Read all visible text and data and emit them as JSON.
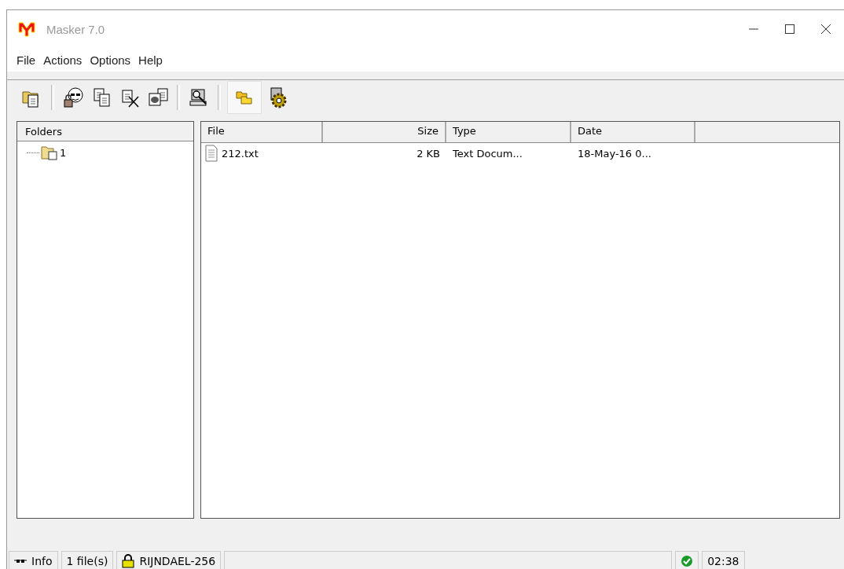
{
  "window": {
    "title": "Masker 7.0"
  },
  "menu": [
    "File",
    "Actions",
    "Options",
    "Help"
  ],
  "toolbar": [
    [
      {
        "kind": "open-folder",
        "selected": false
      }
    ],
    [
      {
        "kind": "mask-lock",
        "selected": false
      },
      {
        "kind": "copy",
        "selected": false
      },
      {
        "kind": "delete",
        "selected": false
      },
      {
        "kind": "image",
        "selected": false
      }
    ],
    [
      {
        "kind": "search",
        "selected": false
      }
    ],
    [
      {
        "kind": "folders",
        "selected": true
      },
      {
        "kind": "gear",
        "selected": false
      }
    ]
  ],
  "folders": {
    "header": "Folders",
    "items": [
      {
        "label": "1"
      }
    ]
  },
  "files": {
    "columns": [
      {
        "label": "File"
      },
      {
        "label": "Size"
      },
      {
        "label": "Type"
      },
      {
        "label": "Date"
      }
    ],
    "rows": [
      [
        "212.txt",
        "2 KB",
        "Text Docum...",
        "18-May-16 0..."
      ]
    ]
  },
  "status_bar": {
    "info": "Info",
    "count": "1 file(s)",
    "cipher": "RIJNDAEL-256",
    "time": "02:38"
  }
}
